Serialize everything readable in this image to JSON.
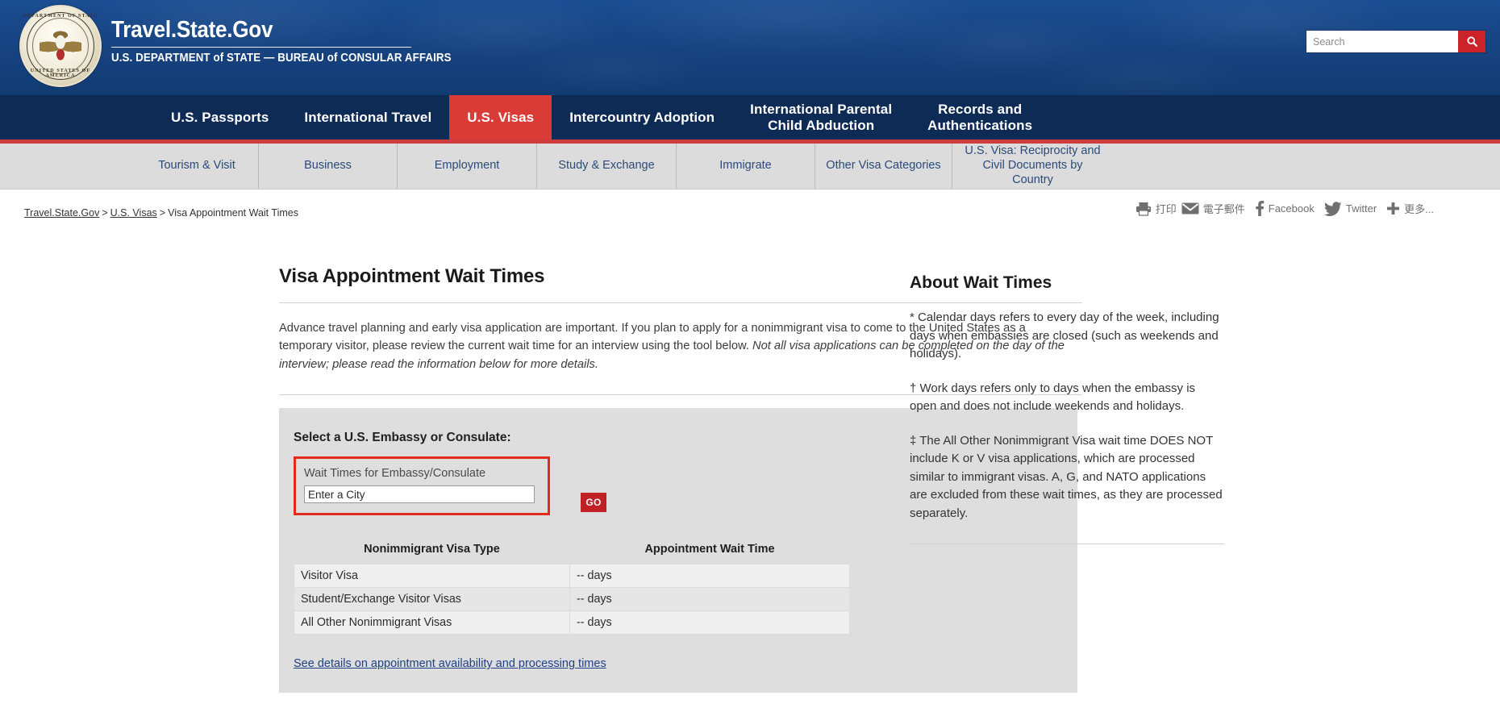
{
  "header": {
    "brand_title": "Travel.State.Gov",
    "brand_subtitle": "U.S. DEPARTMENT of STATE — BUREAU of CONSULAR AFFAIRS",
    "seal_text_top": "DEPARTMENT OF STATE",
    "seal_text_bottom": "UNITED STATES OF AMERICA",
    "search_placeholder": "Search",
    "search_value": "",
    "search_icon": "search-icon"
  },
  "mainnav": [
    {
      "label": "U.S. Passports",
      "active": false
    },
    {
      "label": "International Travel",
      "active": false
    },
    {
      "label": "U.S. Visas",
      "active": true
    },
    {
      "label": "Intercountry Adoption",
      "active": false
    },
    {
      "label": "International Parental\nChild Abduction",
      "active": false
    },
    {
      "label": "Records and\nAuthentications",
      "active": false
    }
  ],
  "subnav": [
    {
      "label": "Tourism & Visit"
    },
    {
      "label": "Business"
    },
    {
      "label": "Employment"
    },
    {
      "label": "Study & Exchange"
    },
    {
      "label": "Immigrate"
    },
    {
      "label": "Other Visa Categories"
    },
    {
      "label": "U.S. Visa: Reciprocity and\nCivil Documents by\nCountry"
    }
  ],
  "breadcrumb": {
    "item1": "Travel.State.Gov",
    "sep1": ">",
    "item2": "U.S. Visas",
    "sep2": ">",
    "current": "Visa Appointment Wait Times"
  },
  "share": {
    "print_icon": "printer-icon",
    "print_label": "打印",
    "email_icon": "envelope-icon",
    "email_label": "電子郵件",
    "facebook_icon": "facebook-icon",
    "facebook_label": "Facebook",
    "twitter_icon": "twitter-icon",
    "twitter_label": "Twitter",
    "more_icon": "plus-icon",
    "more_label": "更多..."
  },
  "main": {
    "title": "Visa Appointment Wait Times",
    "intro_part1": "Advance travel planning and early visa application are important. If you plan to apply for a nonimmigrant visa to come to the United States as a temporary visitor, please review the current wait time for an interview using the tool below. ",
    "intro_italic": "Not all visa applications can be completed on the day of the interview; please read the information below for more details.",
    "tool_label": "Select a U.S. Embassy or Consulate:",
    "lookup_legend": "Wait Times for Embassy/Consulate",
    "city_placeholder": "Enter a City",
    "city_value": "",
    "go_label": "GO",
    "table": {
      "headers": [
        "Nonimmigrant Visa Type",
        "Appointment Wait Time"
      ],
      "rows": [
        {
          "type": "Visitor Visa",
          "wait": "-- days"
        },
        {
          "type": "Student/Exchange Visitor Visas",
          "wait": "-- days"
        },
        {
          "type": "All Other Nonimmigrant Visas",
          "wait": "-- days"
        }
      ]
    },
    "detail_link": "See details on appointment availability and processing times"
  },
  "sidebar": {
    "title": "About Wait Times",
    "p1": "* Calendar days refers to every day of the week, including days when embassies are closed (such as weekends and holidays).",
    "p2": "† Work days refers only to days when the embassy is open and does not include weekends and holidays.",
    "p3": "‡ The All Other Nonimmigrant Visa wait time DOES NOT include K or V visa applications, which are processed similar to immigrant visas.  A, G, and NATO applications are excluded from these wait times, as they are processed separately."
  },
  "colors": {
    "header_blue": "#14407f",
    "nav_blue": "#0d2b55",
    "accent_red": "#d93b36",
    "btn_red": "#bf2026",
    "highlight_red": "#e22b19",
    "link_blue": "#1f3f86"
  }
}
